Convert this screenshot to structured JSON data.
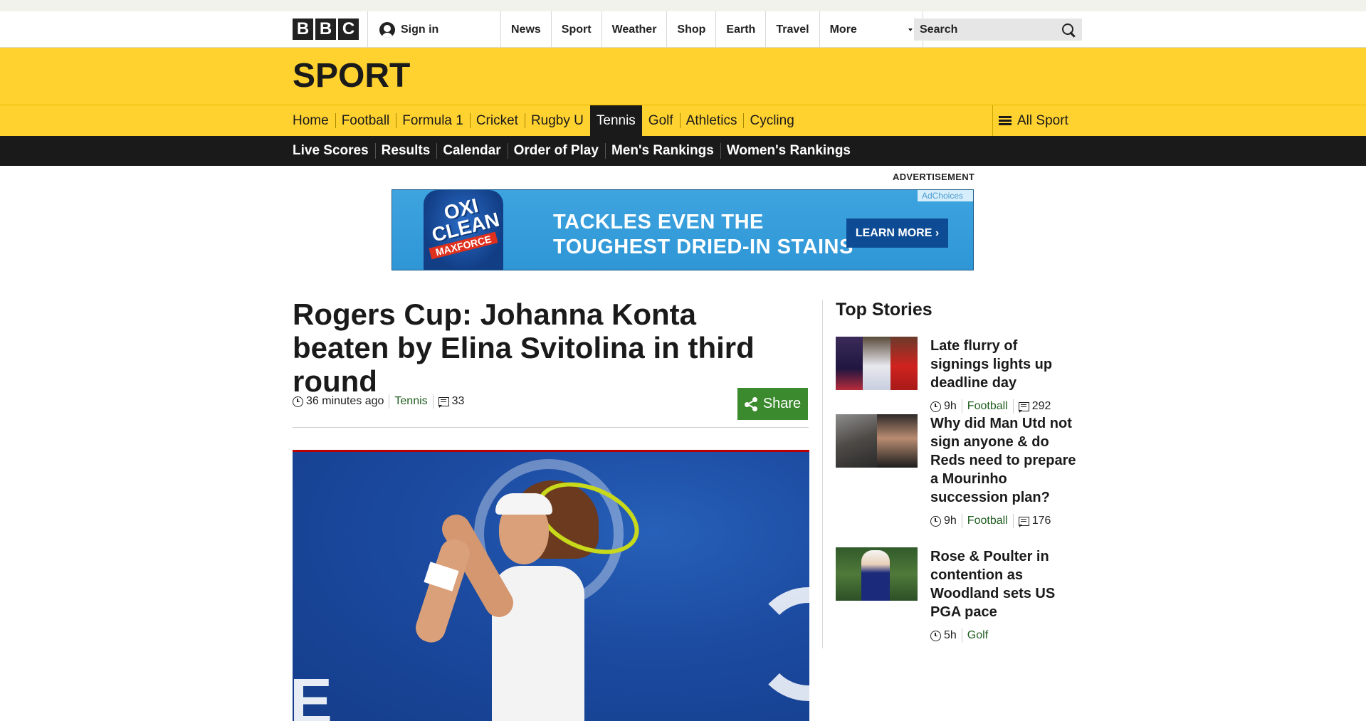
{
  "masthead": {
    "logo_letters": [
      "B",
      "B",
      "C"
    ],
    "signin_label": "Sign in",
    "nav": [
      "News",
      "Sport",
      "Weather",
      "Shop",
      "Earth",
      "Travel",
      "More"
    ],
    "search_placeholder": "Search"
  },
  "sport": {
    "title": "SPORT",
    "nav": [
      "Home",
      "Football",
      "Formula 1",
      "Cricket",
      "Rugby U",
      "Tennis",
      "Golf",
      "Athletics",
      "Cycling"
    ],
    "active": "Tennis",
    "all_sport_label": "All Sport",
    "sub_nav": [
      "Live Scores",
      "Results",
      "Calendar",
      "Order of Play",
      "Men's Rankings",
      "Women's Rankings"
    ]
  },
  "ad": {
    "label": "ADVERTISEMENT",
    "brand": "OXI CLEAN",
    "product": "MAXFORCE",
    "headline_line1": "TACKLES EVEN THE",
    "headline_line2": "TOUGHEST DRIED-IN STAINS",
    "cta": "LEARN MORE ›",
    "choices": "AdChoices",
    "colors": {
      "background": "#3ea4e0",
      "cta": "#0d4c94"
    }
  },
  "article": {
    "title": "Rogers Cup: Johanna Konta beaten by Elina Svitolina in third round",
    "time": "36 minutes ago",
    "section": "Tennis",
    "comments": "33",
    "share_label": "Share"
  },
  "sidebar": {
    "heading": "Top Stories",
    "stories": [
      {
        "title": "Late flurry of signings lights up deadline day",
        "time": "9h",
        "section": "Football",
        "comments": "292"
      },
      {
        "title": "Why did Man Utd not sign anyone & do Reds need to prepare a Mourinho succession plan?",
        "time": "9h",
        "section": "Football",
        "comments": "176"
      },
      {
        "title": "Rose & Poulter in contention as Woodland sets US PGA pace",
        "time": "5h",
        "section": "Golf"
      }
    ]
  },
  "colors": {
    "sport_yellow": "#ffd230",
    "dark": "#1a1a1a",
    "share_green": "#3c8a2e",
    "link_green": "#1f5d1f"
  }
}
